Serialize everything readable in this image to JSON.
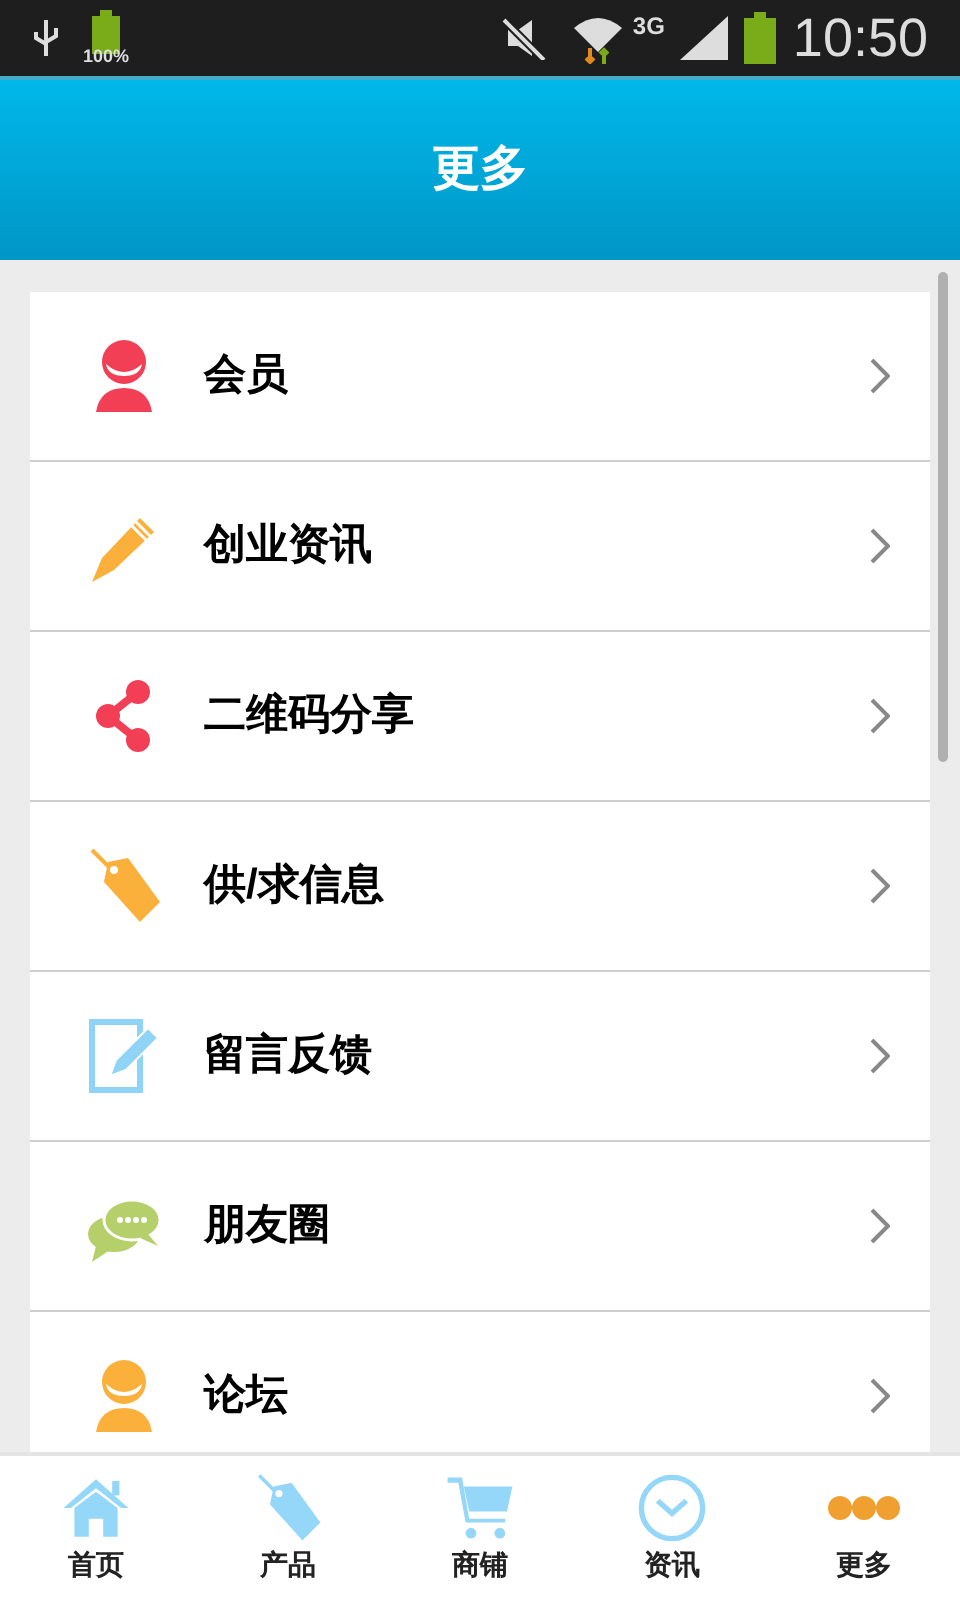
{
  "status_bar": {
    "battery_label": "100%",
    "network": "3G",
    "time": "10:50"
  },
  "header": {
    "title": "更多"
  },
  "menu": [
    {
      "label": "会员",
      "kind": "person",
      "color": "#f23f55"
    },
    {
      "label": "创业资讯",
      "kind": "pencil",
      "color": "#fbb03b"
    },
    {
      "label": "二维码分享",
      "kind": "share",
      "color": "#f23f55"
    },
    {
      "label": "供/求信息",
      "kind": "tag",
      "color": "#fbb03b"
    },
    {
      "label": "留言反馈",
      "kind": "note",
      "color": "#8fd3f7"
    },
    {
      "label": "朋友圈",
      "kind": "chat",
      "color": "#b5cf6b"
    },
    {
      "label": "论坛",
      "kind": "person",
      "color": "#fbb03b"
    }
  ],
  "tab_bar": [
    {
      "label": "首页",
      "kind": "home"
    },
    {
      "label": "产品",
      "kind": "tag"
    },
    {
      "label": "商铺",
      "kind": "cart"
    },
    {
      "label": "资讯",
      "kind": "clock"
    },
    {
      "label": "更多",
      "kind": "dots"
    }
  ]
}
